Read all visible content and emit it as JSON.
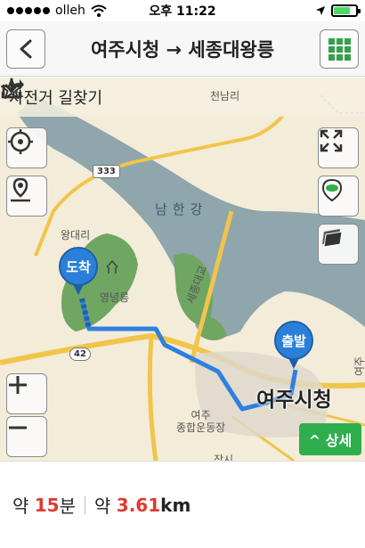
{
  "status_bar": {
    "carrier": "olleh",
    "time": "오후 11:22"
  },
  "nav": {
    "title": "여주시청 → 세종대왕릉",
    "back_icon": "chevron-left-icon",
    "menu_icon": "grid-icon"
  },
  "map": {
    "mode_label": "자전거 길찾기",
    "labels": {
      "cheonnam": "천남리",
      "route_shield": "333",
      "river": "남한강",
      "wangdae": "왕대리",
      "yeongneung": "영녕릉",
      "bridge": "세종대교",
      "route_42": "42",
      "yeoju_sports": "여주\n종합운동장",
      "yeoju_city_hall": "여주시청",
      "bottom_partial": "장시",
      "right_partial": "여주"
    },
    "pins": {
      "destination": "도착",
      "origin": "출발"
    },
    "detail_button": "^ 상세",
    "colors": {
      "route": "#2f7fe0",
      "river": "#8fa6ad",
      "park": "#6ea662",
      "road": "#f0c54a"
    }
  },
  "summary": {
    "time_prefix": "약",
    "time_value": "15",
    "time_unit": "분",
    "distance_prefix": "약",
    "distance_value": "3.61",
    "distance_unit": "km"
  }
}
